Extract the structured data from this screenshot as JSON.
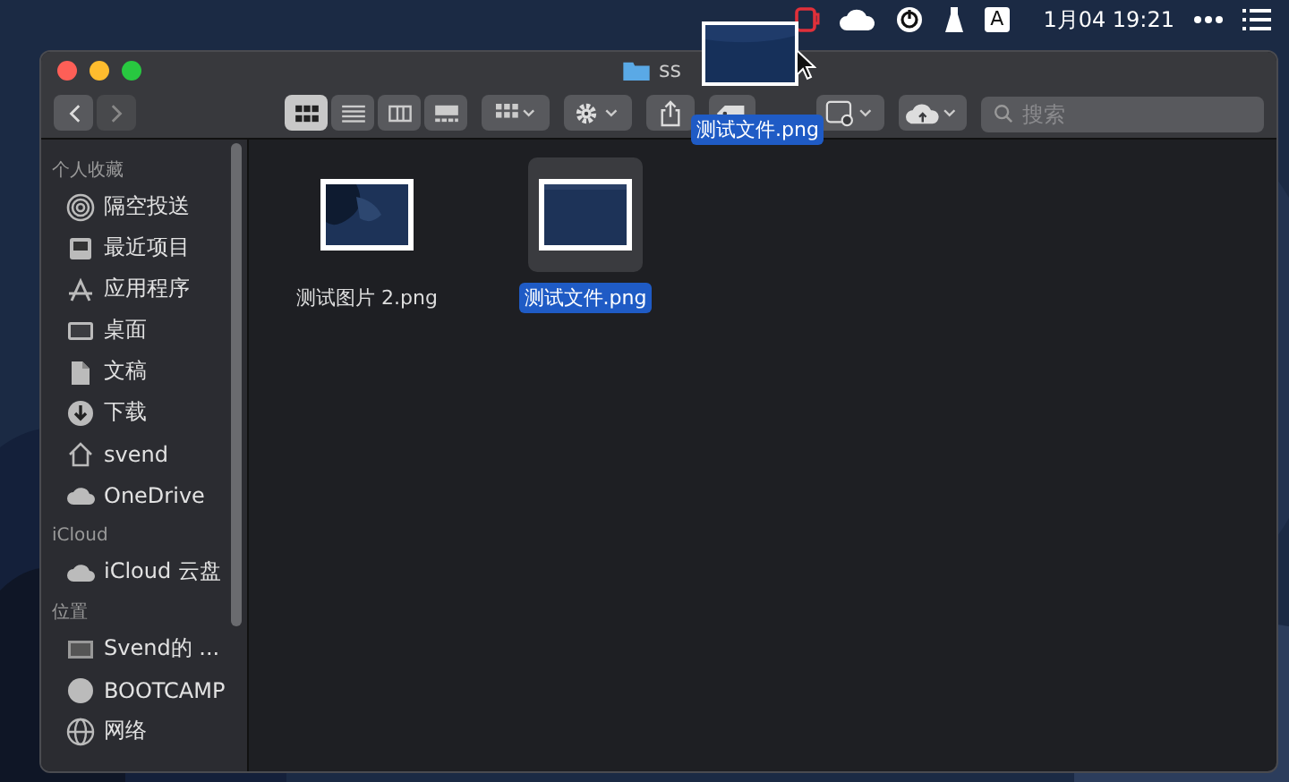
{
  "menu_bar": {
    "input_source": "A",
    "clock": "1月04 19:21"
  },
  "window": {
    "title": "ss",
    "search": {
      "placeholder": "搜索"
    }
  },
  "view_modes": [
    {
      "kind": "icons",
      "selected": true
    },
    {
      "kind": "list",
      "selected": false
    },
    {
      "kind": "columns",
      "selected": false
    },
    {
      "kind": "gallery",
      "selected": false
    }
  ],
  "sidebar": {
    "sections": [
      {
        "heading": "个人收藏",
        "items": [
          {
            "label": "隔空投送",
            "kind": "airdrop"
          },
          {
            "label": "最近项目",
            "kind": "recent"
          },
          {
            "label": "应用程序",
            "kind": "apps"
          },
          {
            "label": "桌面",
            "kind": "desktop"
          },
          {
            "label": "文稿",
            "kind": "docs"
          },
          {
            "label": "下载",
            "kind": "download"
          },
          {
            "label": "svend",
            "kind": "home"
          },
          {
            "label": "OneDrive",
            "kind": "cloud"
          }
        ]
      },
      {
        "heading": "iCloud",
        "items": [
          {
            "label": "iCloud 云盘",
            "kind": "cloud"
          }
        ]
      },
      {
        "heading": "位置",
        "items": [
          {
            "label": "Svend的 ...",
            "kind": "laptop"
          },
          {
            "label": "BOOTCAMP",
            "kind": "disk"
          },
          {
            "label": "网络",
            "kind": "globe"
          }
        ]
      }
    ]
  },
  "files": [
    {
      "name": "测试图片 2.png",
      "selected": false
    },
    {
      "name": "测试文件.png",
      "selected": true
    }
  ],
  "drag_preview": {
    "label": "测试文件.png"
  }
}
